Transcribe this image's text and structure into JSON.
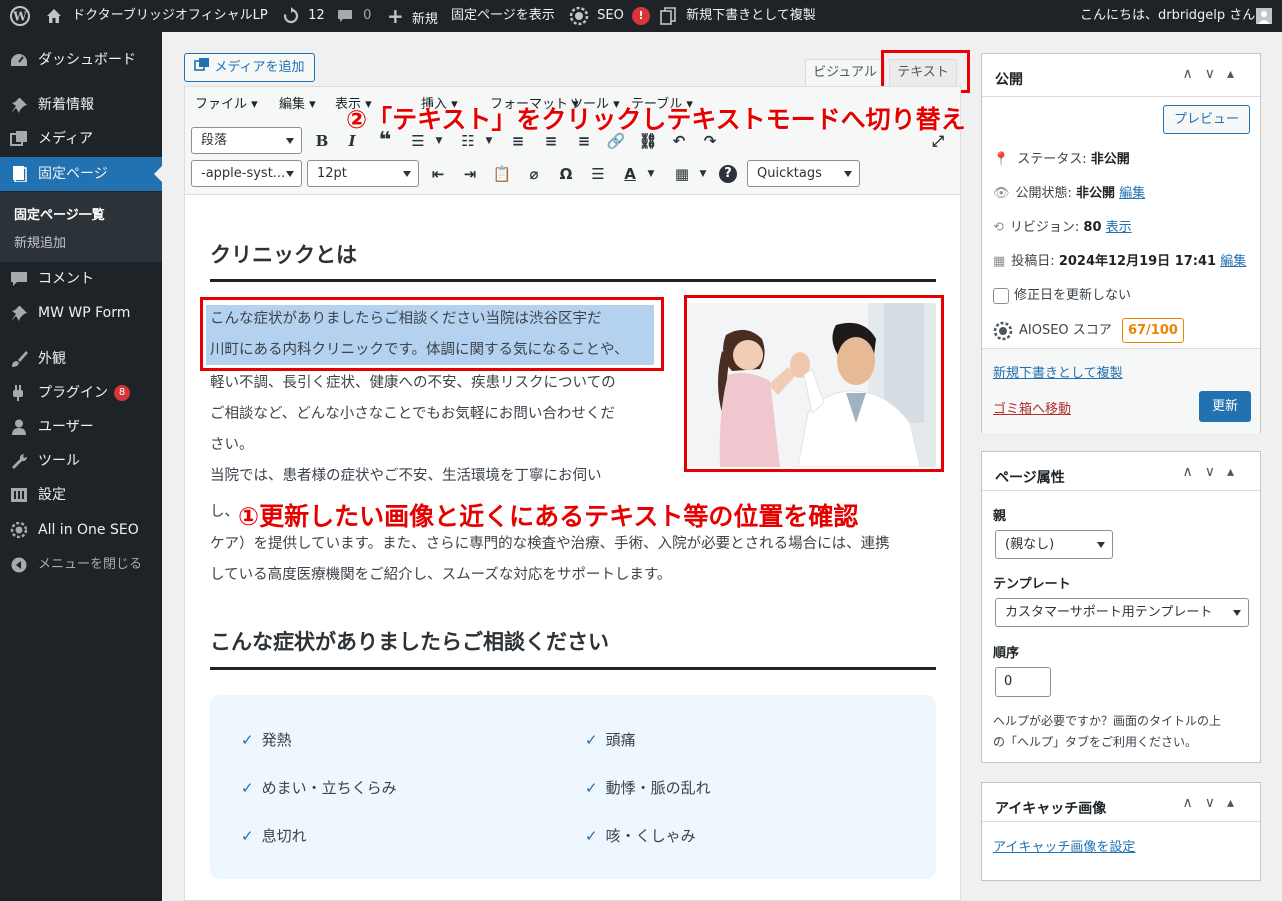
{
  "adminbar": {
    "site_name": "ドクターブリッジオフィシャルLP",
    "updates_count": "12",
    "comments_count": "0",
    "new_label": "新規",
    "view_page": "固定ページを表示",
    "seo_label": "SEO",
    "seo_alert": "!",
    "duplicate": "新規下書きとして複製",
    "greeting": "こんにちは、drbridgelp さん"
  },
  "sidebar": {
    "items": [
      {
        "label": "ダッシュボード",
        "icon": "dashboard-icon"
      },
      {
        "label": "新着情報",
        "icon": "pin-icon"
      },
      {
        "label": "メディア",
        "icon": "media-icon"
      },
      {
        "label": "固定ページ",
        "icon": "page-icon"
      },
      {
        "label": "コメント",
        "icon": "comment-icon"
      },
      {
        "label": "MW WP Form",
        "icon": "pin-icon"
      },
      {
        "label": "外観",
        "icon": "brush-icon"
      },
      {
        "label": "プラグイン",
        "icon": "plugin-icon",
        "badge": "8"
      },
      {
        "label": "ユーザー",
        "icon": "user-icon"
      },
      {
        "label": "ツール",
        "icon": "wrench-icon"
      },
      {
        "label": "設定",
        "icon": "settings-icon"
      },
      {
        "label": "All in One SEO",
        "icon": "aioseo-icon"
      },
      {
        "label": "メニューを閉じる",
        "icon": "collapse-icon"
      }
    ],
    "submenu": [
      "固定ページ一覧",
      "新規追加"
    ]
  },
  "editor": {
    "add_media": "メディアを追加",
    "tab_visual": "ビジュアル",
    "tab_text": "テキスト",
    "menubar": [
      "ファイル",
      "編集",
      "表示",
      "挿入",
      "フォーマット",
      "ツール",
      "テーブル"
    ],
    "format_select": "段落",
    "font_select": "-apple-syst...",
    "size_select": "12pt",
    "quicktags": "Quicktags"
  },
  "content": {
    "heading1": "クリニックとは",
    "para_lines": [
      "こんな症状がありましたらご相談ください当院は渋谷区宇だ",
      "川町にある内科クリニックです。体調に関する気になることや、",
      "軽い不調、長引く症状、健康への不安、疾患リスクについての",
      "ご相談など、どんな小さなことでもお気軽にお問い合わせくだ",
      "さい。",
      "当院では、患者様の症状やご不安、生活環境を丁寧にお伺い",
      "し、",
      "ケア）を提供しています。また、さらに専門的な検査や治療、手術、入院が必要とされる場合には、連携",
      "している高度医療機関をご紹介し、スムーズな対応をサポートします。"
    ],
    "heading2": "こんな症状がありましたらご相談ください",
    "symptoms": [
      "発熱",
      "頭痛",
      "めまい・立ちくらみ",
      "動悸・脈の乱れ",
      "息切れ",
      "咳・くしゃみ"
    ]
  },
  "annotations": {
    "a1": "①更新したい画像と近くにあるテキスト等の位置を確認",
    "a2": "②「テキスト」をクリックしテキストモードへ切り替え"
  },
  "publish": {
    "title": "公開",
    "preview": "プレビュー",
    "status_label": "ステータス: ",
    "status_value": "非公開",
    "visibility_label": "公開状態: ",
    "visibility_value": "非公開",
    "edit": "編集",
    "revision_label": "リビジョン: ",
    "revision_value": "80",
    "show": "表示",
    "date_label": "投稿日: ",
    "date_value": "2024年12月19日 17:41",
    "edit2": "編集",
    "no_update_date": "修正日を更新しない",
    "aioseo_label": "AIOSEO スコア",
    "aioseo_score": "67/100",
    "duplicate": "新規下書きとして複製",
    "trash": "ゴミ箱へ移動",
    "update": "更新"
  },
  "attributes": {
    "title": "ページ属性",
    "parent_label": "親",
    "parent_value": "(親なし)",
    "template_label": "テンプレート",
    "template_value": "カスタマーサポート用テンプレート",
    "order_label": "順序",
    "order_value": "0",
    "help1": "ヘルプが必要ですか？画面のタイトルの上",
    "help2": "の「ヘルプ」タブをご利用ください。"
  },
  "featured": {
    "title": "アイキャッチ画像",
    "set": "アイキャッチ画像を設定"
  }
}
